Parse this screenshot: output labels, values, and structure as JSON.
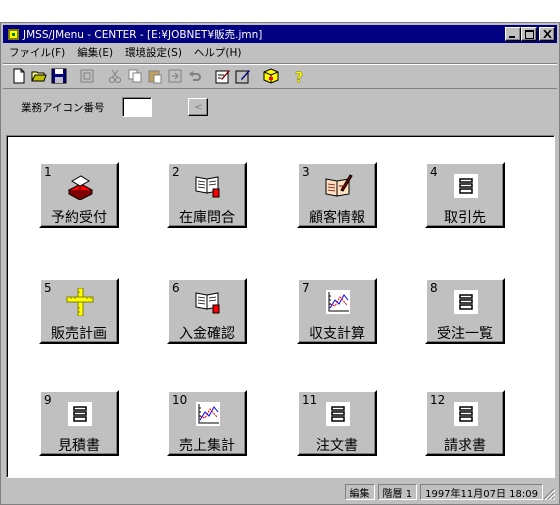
{
  "window": {
    "title": "JMSS/JMenu - CENTER - [E:¥JOBNET¥販売.jmn]",
    "buttons": {
      "minimize": "_",
      "maximize": "□",
      "close": "✕"
    }
  },
  "menu": [
    {
      "label": "ファイル(F)"
    },
    {
      "label": "編集(E)"
    },
    {
      "label": "環境設定(S)"
    },
    {
      "label": "ヘルプ(H)"
    }
  ],
  "toolbar": {
    "icons": [
      "new-file-icon",
      "open-folder-icon",
      "save-icon",
      "properties-icon",
      "cut-icon",
      "copy-icon",
      "paste-icon",
      "import-icon",
      "undo-icon",
      "edit-icon",
      "check-edit-icon",
      "cube-icon",
      "help-icon"
    ]
  },
  "business_row": {
    "label": "業務アイコン番号",
    "input_value": "",
    "button_glyph": "<"
  },
  "tiles": [
    {
      "num": "1",
      "label": "予約受付",
      "icon": "reservation-icon"
    },
    {
      "num": "2",
      "label": "在庫問合",
      "icon": "book-icon"
    },
    {
      "num": "3",
      "label": "顧客情報",
      "icon": "customer-book-icon"
    },
    {
      "num": "4",
      "label": "取引先",
      "icon": "document-icon"
    },
    {
      "num": "5",
      "label": "販売計画",
      "icon": "ruler-icon"
    },
    {
      "num": "6",
      "label": "入金確認",
      "icon": "book-icon"
    },
    {
      "num": "7",
      "label": "収支計算",
      "icon": "chart-icon"
    },
    {
      "num": "8",
      "label": "受注一覧",
      "icon": "document-icon"
    },
    {
      "num": "9",
      "label": "見積書",
      "icon": "document-icon"
    },
    {
      "num": "10",
      "label": "売上集計",
      "icon": "chart-icon"
    },
    {
      "num": "11",
      "label": "注文書",
      "icon": "document-icon"
    },
    {
      "num": "12",
      "label": "請求書",
      "icon": "document-icon"
    }
  ],
  "status": {
    "mode": "編集",
    "level": "階層 1",
    "datetime": "1997年11月07日 18:09"
  }
}
